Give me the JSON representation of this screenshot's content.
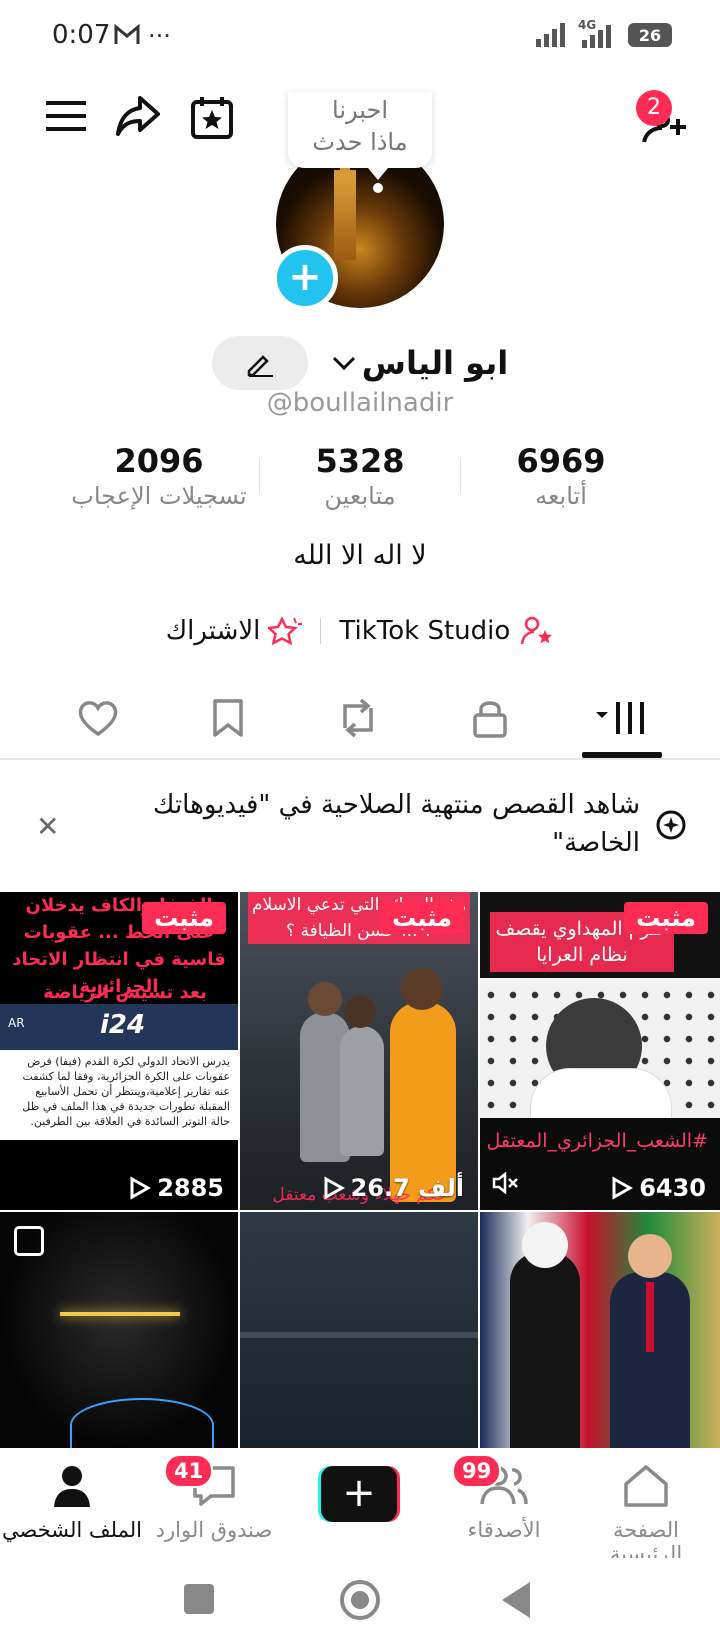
{
  "status_bar": {
    "time": "0:07",
    "network": "4G",
    "battery": "26"
  },
  "header": {
    "notification_count": "2"
  },
  "avatar": {
    "tooltip": "احبرنا ماذا حدث"
  },
  "profile": {
    "name": "ابو الياس",
    "handle": "@boullailnadir",
    "bio": "لا اله الا الله"
  },
  "stats": [
    {
      "value": "6969",
      "label": "أتابعه"
    },
    {
      "value": "5328",
      "label": "متابعين"
    },
    {
      "value": "2096",
      "label": "تسجيلات الإعجاب"
    }
  ],
  "links": {
    "studio": "TikTok Studio",
    "subscribe": "الاشتراك"
  },
  "banner": {
    "text": "شاهد القصص منتهية الصلاحية في \"فيديوهاتك الخاصة\""
  },
  "videos": [
    {
      "pinned": "مثبت",
      "views": "6430",
      "caption_top": "حترم المهداوي يقصف نظام العرايا",
      "caption_bottom": "#الشعب_الجزائري_المعتقل"
    },
    {
      "pinned": "مثبت",
      "views": "26.7 ألف",
      "caption_top": "هذه الجزائر التي تدعي الاسلام ؟ ... حسن الظيافة ؟",
      "caption_bottom": "حكم جهلاء وشعب معتقل"
    },
    {
      "pinned": "مثبت",
      "views": "2885",
      "caption_top": "الفيفا والكاف يدخلان على الخط ... عقوبات قاسية في انتظار الاتحاد الجزائرية",
      "caption_mid": "بعد تسيس الرياضة",
      "news_logo": "i24",
      "news_lang": "AR",
      "article": "يدرس الاتحاد الدولي لكرة القدم (فيفا) فرض عقوبات على الكرة الجزائرية، وفقا لما كشفت عنه تقارير إعلامية،وينتظر أن تحمل الأسابيع المقبلة تطورات جديدة في هذا الملف في ظل حالة التوتر السائدة في العلاقة بين الطرفين."
    },
    {
      "views": ""
    },
    {
      "views": ""
    },
    {
      "views": ""
    }
  ],
  "bottom_nav": {
    "home": "الصفحة الرئيسية",
    "friends": "الأصدقاء",
    "friends_badge": "99",
    "inbox": "صندوق الوارد",
    "inbox_badge": "41",
    "profile": "الملف الشخصي"
  }
}
